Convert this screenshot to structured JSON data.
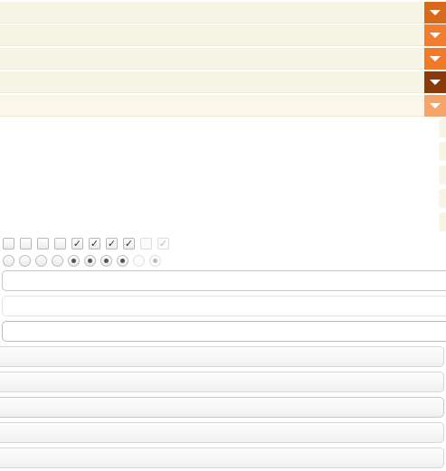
{
  "colors": {
    "bar_bg": "#f7f6e6",
    "button_1": "#d86a1c",
    "button_2": "#f17e2e",
    "button_3": "#f07a28",
    "button_4": "#8a3a0a",
    "button_5": "#f5a46a"
  },
  "dropdowns": [
    {
      "value": "",
      "icon": "chevron-down-icon"
    },
    {
      "value": "",
      "icon": "chevron-down-icon"
    },
    {
      "value": "",
      "icon": "chevron-down-icon"
    },
    {
      "value": "",
      "icon": "chevron-down-icon"
    },
    {
      "value": "",
      "icon": "chevron-down-icon"
    }
  ],
  "checkboxes": [
    {
      "checked": false,
      "mark": ""
    },
    {
      "checked": false,
      "mark": ""
    },
    {
      "checked": false,
      "mark": ""
    },
    {
      "checked": false,
      "mark": ""
    },
    {
      "checked": true,
      "mark": "✓"
    },
    {
      "checked": true,
      "mark": "✓"
    },
    {
      "checked": true,
      "mark": "✓"
    },
    {
      "checked": true,
      "mark": "✓"
    },
    {
      "checked": false,
      "mark": ""
    },
    {
      "checked": true,
      "mark": "✓"
    }
  ],
  "radios": [
    {
      "checked": false
    },
    {
      "checked": false
    },
    {
      "checked": false
    },
    {
      "checked": false
    },
    {
      "checked": true
    },
    {
      "checked": true
    },
    {
      "checked": true
    },
    {
      "checked": true
    },
    {
      "checked": false
    },
    {
      "checked": true
    }
  ],
  "inputs": [
    {
      "value": "",
      "placeholder": ""
    },
    {
      "value": "",
      "placeholder": ""
    },
    {
      "value": "",
      "placeholder": ""
    }
  ],
  "buttons": [
    {
      "label": ""
    },
    {
      "label": ""
    },
    {
      "label": ""
    },
    {
      "label": ""
    },
    {
      "label": ""
    }
  ]
}
